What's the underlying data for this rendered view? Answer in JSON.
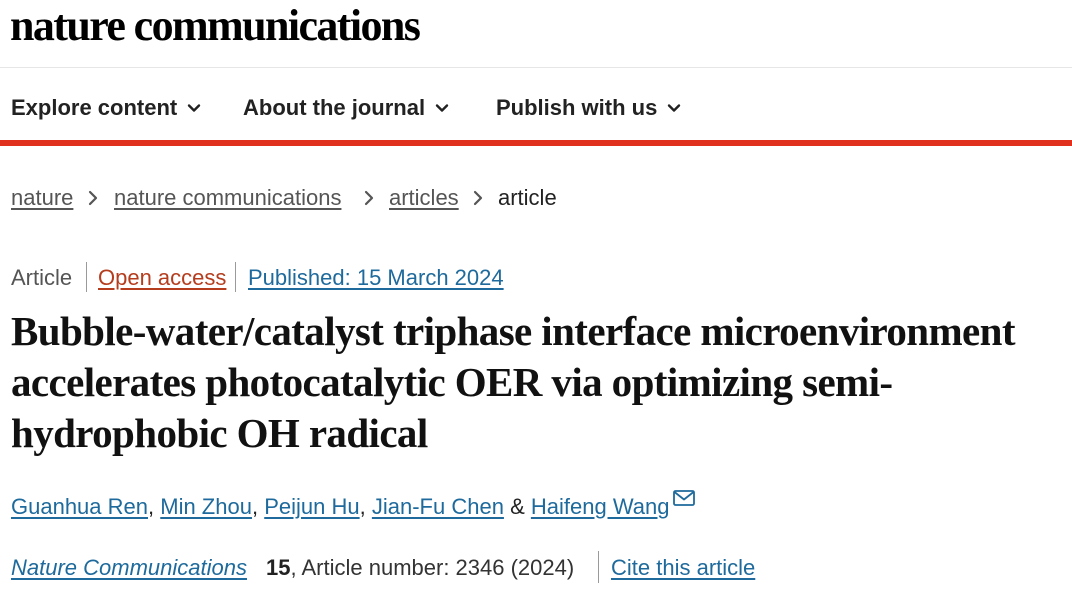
{
  "site": {
    "logo": "nature communications"
  },
  "nav": {
    "items": [
      {
        "label": "Explore content",
        "icon": "chevron-down-icon"
      },
      {
        "label": "About the journal",
        "icon": "chevron-down-icon"
      },
      {
        "label": "Publish with us",
        "icon": "chevron-down-icon"
      }
    ],
    "accent_color": "#e0301e"
  },
  "breadcrumb": {
    "items": [
      "nature",
      "nature communications",
      "articles"
    ],
    "current": "article",
    "separator_icon": "chevron-right-icon"
  },
  "article": {
    "type": "Article",
    "access": "Open access",
    "published": "Published: 15 March 2024",
    "title": "Bubble-water/catalyst triphase interface microenvironment accelerates photocatalytic OER via optimizing semi-hydrophobic OH radical",
    "authors": [
      "Guanhua Ren",
      "Min Zhou",
      "Peijun Hu",
      "Jian-Fu Chen",
      "Haifeng Wang"
    ],
    "author_separator": ",",
    "author_last_separator": "&",
    "corresponding_icon": "mail-icon",
    "journal": "Nature Communications",
    "volume": "15",
    "article_number": ", Article number: 2346 (2024)",
    "cite_label": "Cite this article",
    "link_color": "#1e6a9c",
    "open_access_color": "#b53d1e"
  }
}
